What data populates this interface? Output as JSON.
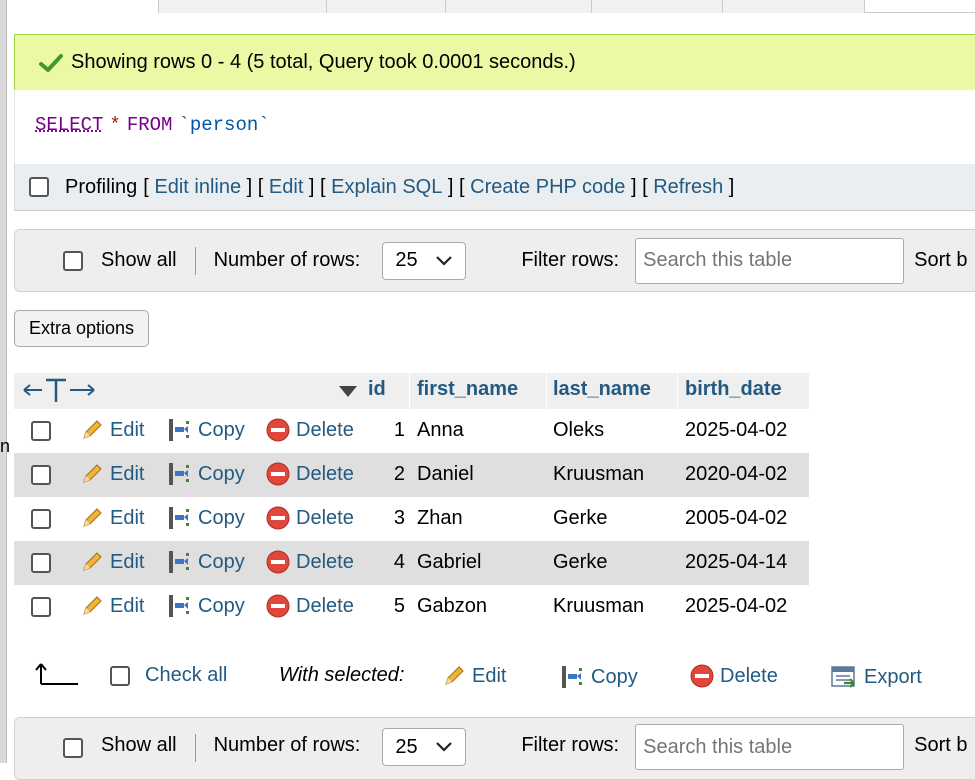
{
  "success_message": "Showing rows 0 - 4 (5 total, Query took 0.0001 seconds.)",
  "sql": {
    "select": "SELECT",
    "star": "*",
    "from": "FROM",
    "table": "`person`"
  },
  "profiling": {
    "label": "Profiling",
    "links": [
      "Edit inline",
      "Edit",
      "Explain SQL",
      "Create PHP code",
      "Refresh"
    ]
  },
  "nav": {
    "show_all": "Show all",
    "rows_label": "Number of rows:",
    "rows_value": "25",
    "filter_label": "Filter rows:",
    "search_placeholder": "Search this table",
    "sort_label": "Sort b"
  },
  "extra_options": "Extra options",
  "table": {
    "columns": [
      "id",
      "first_name",
      "last_name",
      "birth_date"
    ],
    "action_labels": {
      "edit": "Edit",
      "copy": "Copy",
      "delete": "Delete"
    },
    "rows": [
      {
        "id": "1",
        "first_name": "Anna",
        "last_name": "Oleks",
        "birth_date": "2025-04-02"
      },
      {
        "id": "2",
        "first_name": "Daniel",
        "last_name": "Kruusman",
        "birth_date": "2020-04-02"
      },
      {
        "id": "3",
        "first_name": "Zhan",
        "last_name": "Gerke",
        "birth_date": "2005-04-02"
      },
      {
        "id": "4",
        "first_name": "Gabriel",
        "last_name": "Gerke",
        "birth_date": "2025-04-14"
      },
      {
        "id": "5",
        "first_name": "Gabzon",
        "last_name": "Kruusman",
        "birth_date": "2025-04-02"
      }
    ]
  },
  "footer": {
    "check_all": "Check all",
    "with_selected": "With selected:",
    "edit": "Edit",
    "copy": "Copy",
    "delete": "Delete",
    "export": "Export"
  },
  "left_edge_char": "n",
  "colors": {
    "link": "#235a81",
    "success_bg": "#ebf8a4",
    "row_alt": "#dfdfdf"
  }
}
